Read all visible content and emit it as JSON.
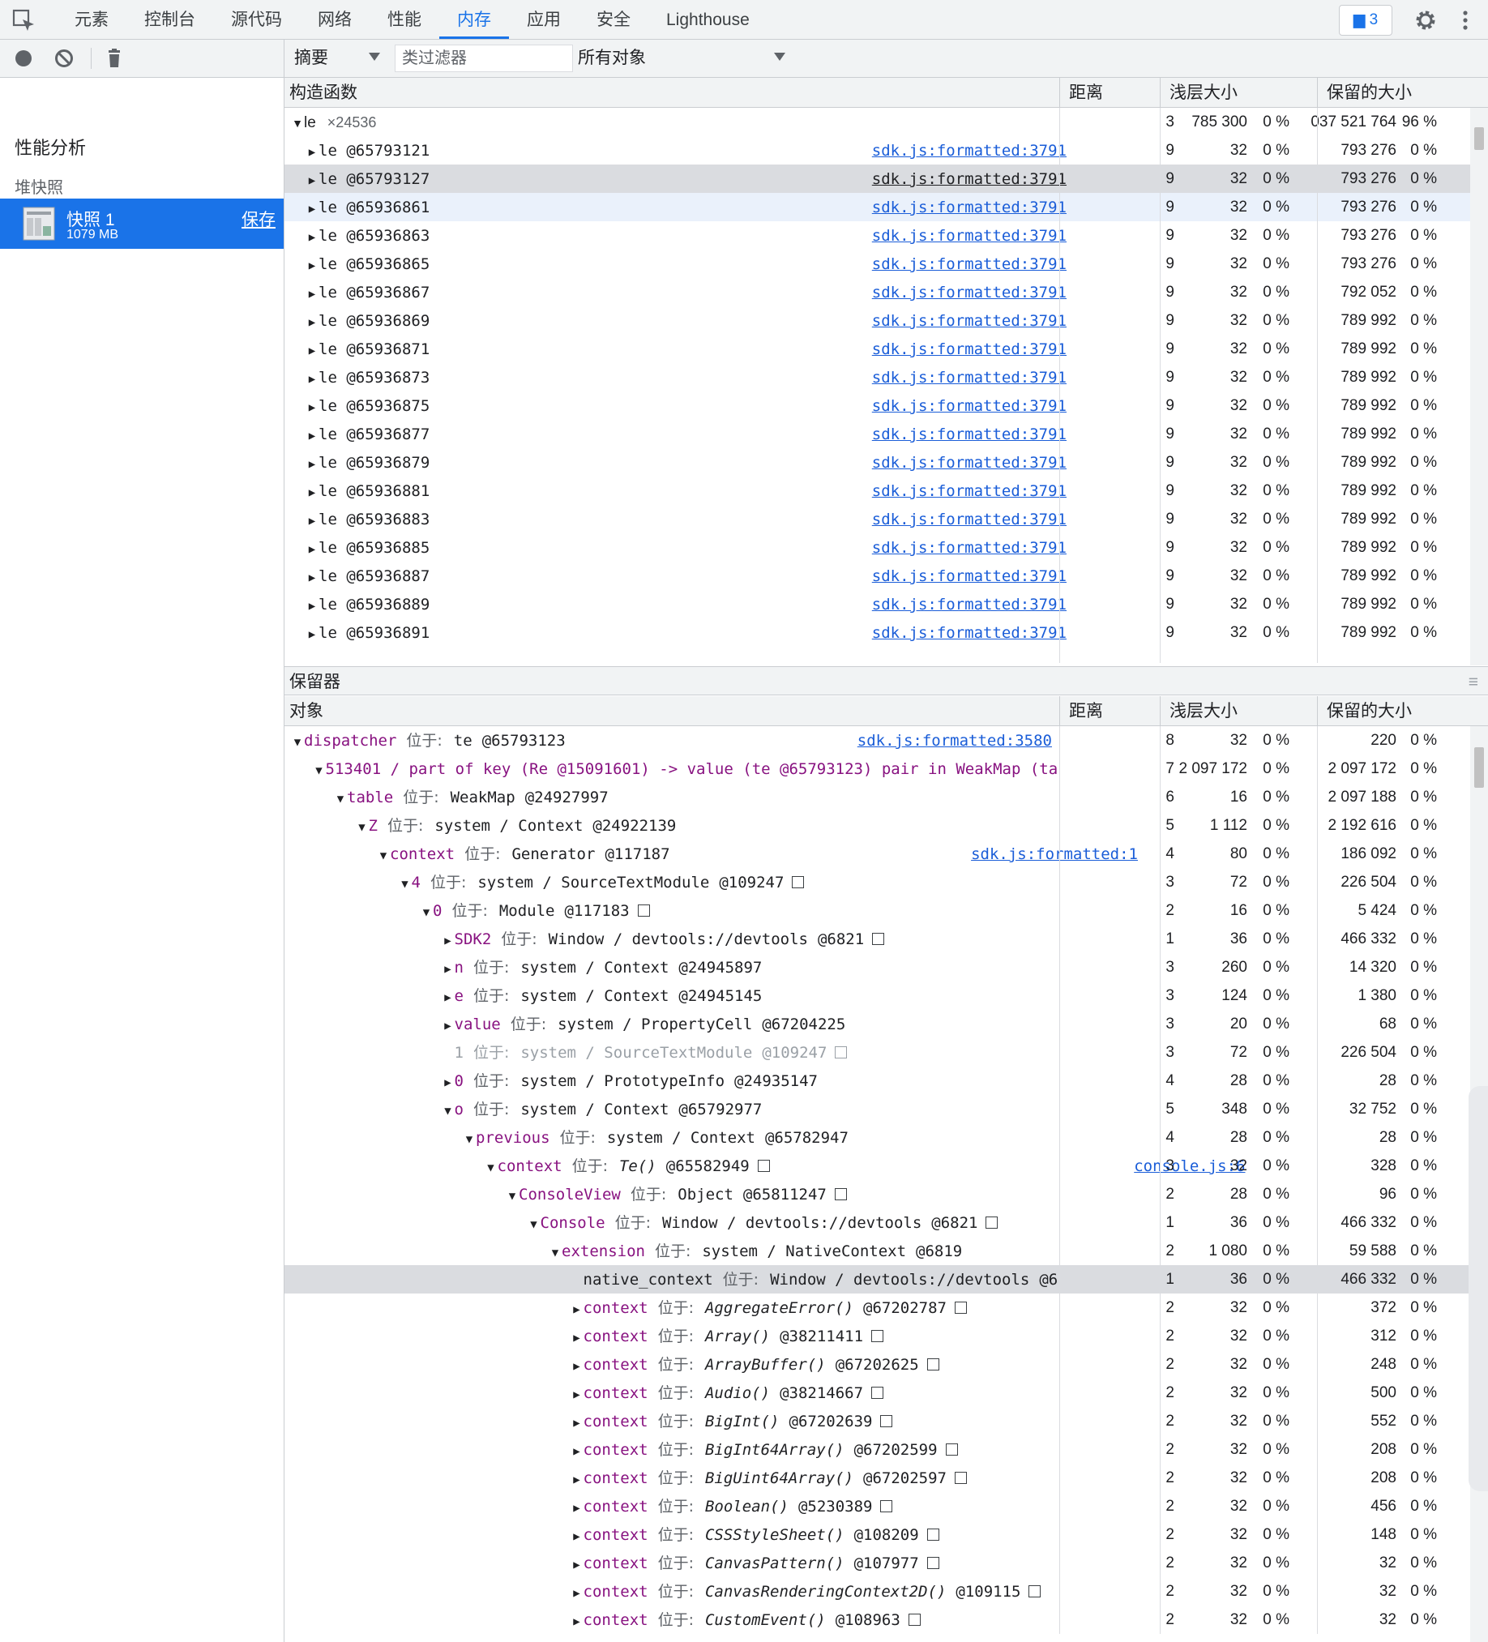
{
  "tabs": [
    "元素",
    "控制台",
    "源代码",
    "网络",
    "性能",
    "内存",
    "应用",
    "安全",
    "Lighthouse"
  ],
  "active_tab": "内存",
  "issues_badge": "3",
  "left": {
    "title": "性能分析",
    "heap_label": "堆快照",
    "snapshot": {
      "name": "快照 1",
      "size": "1079 MB",
      "save": "保存"
    }
  },
  "toolbar": {
    "view": "摘要",
    "class_filter": "类过滤器",
    "objects": "所有对象"
  },
  "top_columns": {
    "name": "构造函数",
    "distance": "距离",
    "shallow": "浅层大小",
    "retained": "保留的大小"
  },
  "top_group": {
    "name": "le",
    "count": "×24536",
    "distance": "3",
    "shallow": "785 300",
    "shallow_pct": "0 %",
    "retained": "037 521 764",
    "retained_pct": "96 %"
  },
  "top_rows": [
    {
      "id": "le @65793121",
      "link": "sdk.js:formatted:3791",
      "distance": "9",
      "shallow": "32",
      "shallow_pct": "0 %",
      "retained": "793 276",
      "retained_pct": "0 %"
    },
    {
      "id": "le @65793127",
      "link": "sdk.js:formatted:3791",
      "distance": "9",
      "shallow": "32",
      "shallow_pct": "0 %",
      "retained": "793 276",
      "retained_pct": "0 %"
    },
    {
      "id": "le @65936861",
      "link": "sdk.js:formatted:3791",
      "distance": "9",
      "shallow": "32",
      "shallow_pct": "0 %",
      "retained": "793 276",
      "retained_pct": "0 %"
    },
    {
      "id": "le @65936863",
      "link": "sdk.js:formatted:3791",
      "distance": "9",
      "shallow": "32",
      "shallow_pct": "0 %",
      "retained": "793 276",
      "retained_pct": "0 %"
    },
    {
      "id": "le @65936865",
      "link": "sdk.js:formatted:3791",
      "distance": "9",
      "shallow": "32",
      "shallow_pct": "0 %",
      "retained": "793 276",
      "retained_pct": "0 %"
    },
    {
      "id": "le @65936867",
      "link": "sdk.js:formatted:3791",
      "distance": "9",
      "shallow": "32",
      "shallow_pct": "0 %",
      "retained": "792 052",
      "retained_pct": "0 %"
    },
    {
      "id": "le @65936869",
      "link": "sdk.js:formatted:3791",
      "distance": "9",
      "shallow": "32",
      "shallow_pct": "0 %",
      "retained": "789 992",
      "retained_pct": "0 %"
    },
    {
      "id": "le @65936871",
      "link": "sdk.js:formatted:3791",
      "distance": "9",
      "shallow": "32",
      "shallow_pct": "0 %",
      "retained": "789 992",
      "retained_pct": "0 %"
    },
    {
      "id": "le @65936873",
      "link": "sdk.js:formatted:3791",
      "distance": "9",
      "shallow": "32",
      "shallow_pct": "0 %",
      "retained": "789 992",
      "retained_pct": "0 %"
    },
    {
      "id": "le @65936875",
      "link": "sdk.js:formatted:3791",
      "distance": "9",
      "shallow": "32",
      "shallow_pct": "0 %",
      "retained": "789 992",
      "retained_pct": "0 %"
    },
    {
      "id": "le @65936877",
      "link": "sdk.js:formatted:3791",
      "distance": "9",
      "shallow": "32",
      "shallow_pct": "0 %",
      "retained": "789 992",
      "retained_pct": "0 %"
    },
    {
      "id": "le @65936879",
      "link": "sdk.js:formatted:3791",
      "distance": "9",
      "shallow": "32",
      "shallow_pct": "0 %",
      "retained": "789 992",
      "retained_pct": "0 %"
    },
    {
      "id": "le @65936881",
      "link": "sdk.js:formatted:3791",
      "distance": "9",
      "shallow": "32",
      "shallow_pct": "0 %",
      "retained": "789 992",
      "retained_pct": "0 %"
    },
    {
      "id": "le @65936883",
      "link": "sdk.js:formatted:3791",
      "distance": "9",
      "shallow": "32",
      "shallow_pct": "0 %",
      "retained": "789 992",
      "retained_pct": "0 %"
    },
    {
      "id": "le @65936885",
      "link": "sdk.js:formatted:3791",
      "distance": "9",
      "shallow": "32",
      "shallow_pct": "0 %",
      "retained": "789 992",
      "retained_pct": "0 %"
    },
    {
      "id": "le @65936887",
      "link": "sdk.js:formatted:3791",
      "distance": "9",
      "shallow": "32",
      "shallow_pct": "0 %",
      "retained": "789 992",
      "retained_pct": "0 %"
    },
    {
      "id": "le @65936889",
      "link": "sdk.js:formatted:3791",
      "distance": "9",
      "shallow": "32",
      "shallow_pct": "0 %",
      "retained": "789 992",
      "retained_pct": "0 %"
    },
    {
      "id": "le @65936891",
      "link": "sdk.js:formatted:3791",
      "distance": "9",
      "shallow": "32",
      "shallow_pct": "0 %",
      "retained": "789 992",
      "retained_pct": "0 %"
    }
  ],
  "retainers_title": "保留器",
  "bottom_columns": {
    "name": "对象",
    "distance": "距离",
    "shallow": "浅层大小",
    "retained": "保留的大小"
  },
  "bottom_rows": [
    {
      "depth": 0,
      "arrow": "▼",
      "prop": "dispatcher",
      "at": "位于:",
      "type": "te",
      "id": "@65793123",
      "link": "sdk.js:formatted:3580",
      "distance": "8",
      "shallow": "32",
      "shallow_pct": "0 %",
      "retained": "220",
      "retained_pct": "0 %"
    },
    {
      "depth": 1,
      "arrow": "▼",
      "prop": "513401 / part of key (Re @15091601) -> value (te @65793123) pair in WeakMap (ta",
      "at": "",
      "type": "",
      "id": "",
      "distance": "7",
      "shallow": "2 097 172",
      "shallow_pct": "0 %",
      "retained": "2 097 172",
      "retained_pct": "0 %"
    },
    {
      "depth": 2,
      "arrow": "▼",
      "prop": "table",
      "at": "位于:",
      "type": "WeakMap",
      "id": "@24927997",
      "distance": "6",
      "shallow": "16",
      "shallow_pct": "0 %",
      "retained": "2 097 188",
      "retained_pct": "0 %"
    },
    {
      "depth": 3,
      "arrow": "▼",
      "prop": "Z",
      "at": "位于:",
      "type": "system / Context",
      "id": "@24922139",
      "distance": "5",
      "shallow": "1 112",
      "shallow_pct": "0 %",
      "retained": "2 192 616",
      "retained_pct": "0 %"
    },
    {
      "depth": 4,
      "arrow": "▼",
      "prop": "context",
      "at": "位于:",
      "type": "Generator",
      "id": "@117187",
      "link": "sdk.js:formatted:1",
      "distance": "4",
      "shallow": "80",
      "shallow_pct": "0 %",
      "retained": "186 092",
      "retained_pct": "0 %"
    },
    {
      "depth": 5,
      "arrow": "▼",
      "prop": "4",
      "at": "位于:",
      "type": "system / SourceTextModule",
      "id": "@109247",
      "box": true,
      "distance": "3",
      "shallow": "72",
      "shallow_pct": "0 %",
      "retained": "226 504",
      "retained_pct": "0 %"
    },
    {
      "depth": 6,
      "arrow": "▼",
      "prop": "0",
      "at": "位于:",
      "type": "Module",
      "id": "@117183",
      "box": true,
      "distance": "2",
      "shallow": "16",
      "shallow_pct": "0 %",
      "retained": "5 424",
      "retained_pct": "0 %"
    },
    {
      "depth": 7,
      "arrow": "▶",
      "prop": "SDK2",
      "at": "位于:",
      "type": "Window / devtools://devtools",
      "id": "@6821",
      "box": true,
      "distance": "1",
      "shallow": "36",
      "shallow_pct": "0 %",
      "retained": "466 332",
      "retained_pct": "0 %"
    },
    {
      "depth": 7,
      "arrow": "▶",
      "prop": "n",
      "at": "位于:",
      "type": "system / Context",
      "id": "@24945897",
      "distance": "3",
      "shallow": "260",
      "shallow_pct": "0 %",
      "retained": "14 320",
      "retained_pct": "0 %"
    },
    {
      "depth": 7,
      "arrow": "▶",
      "prop": "e",
      "at": "位于:",
      "type": "system / Context",
      "id": "@24945145",
      "distance": "3",
      "shallow": "124",
      "shallow_pct": "0 %",
      "retained": "1 380",
      "retained_pct": "0 %"
    },
    {
      "depth": 7,
      "arrow": "▶",
      "prop": "value",
      "at": "位于:",
      "type": "system / PropertyCell",
      "id": "@67204225",
      "distance": "3",
      "shallow": "20",
      "shallow_pct": "0 %",
      "retained": "68",
      "retained_pct": "0 %"
    },
    {
      "depth": 7,
      "arrow": "",
      "prop": "1",
      "at": "位于:",
      "type": "system / SourceTextModule",
      "id": "@109247",
      "box": true,
      "dim": true,
      "distance": "3",
      "shallow": "72",
      "shallow_pct": "0 %",
      "retained": "226 504",
      "retained_pct": "0 %"
    },
    {
      "depth": 7,
      "arrow": "▶",
      "prop": "0",
      "at": "位于:",
      "type": "system / PrototypeInfo",
      "id": "@24935147",
      "distance": "4",
      "shallow": "28",
      "shallow_pct": "0 %",
      "retained": "28",
      "retained_pct": "0 %"
    },
    {
      "depth": 7,
      "arrow": "▼",
      "prop": "o",
      "at": "位于:",
      "type": "system / Context",
      "id": "@65792977",
      "distance": "5",
      "shallow": "348",
      "shallow_pct": "0 %",
      "retained": "32 752",
      "retained_pct": "0 %"
    },
    {
      "depth": 8,
      "arrow": "▼",
      "prop": "previous",
      "at": "位于:",
      "type": "system / Context",
      "id": "@65782947",
      "distance": "4",
      "shallow": "28",
      "shallow_pct": "0 %",
      "retained": "28",
      "retained_pct": "0 %"
    },
    {
      "depth": 9,
      "arrow": "▼",
      "prop": "context",
      "at": "位于:",
      "type": "Te()",
      "italic": true,
      "id": "@65582949",
      "box": true,
      "link": "console.js:6",
      "distance": "3",
      "shallow": "32",
      "shallow_pct": "0 %",
      "retained": "328",
      "retained_pct": "0 %"
    },
    {
      "depth": 10,
      "arrow": "▼",
      "prop": "ConsoleView",
      "at": "位于:",
      "type": "Object",
      "id": "@65811247",
      "box": true,
      "distance": "2",
      "shallow": "28",
      "shallow_pct": "0 %",
      "retained": "96",
      "retained_pct": "0 %"
    },
    {
      "depth": 11,
      "arrow": "▼",
      "prop": "Console",
      "at": "位于:",
      "type": "Window / devtools://devtools",
      "id": "@6821",
      "box": true,
      "distance": "1",
      "shallow": "36",
      "shallow_pct": "0 %",
      "retained": "466 332",
      "retained_pct": "0 %"
    },
    {
      "depth": 12,
      "arrow": "▼",
      "prop": "extension",
      "at": "位于:",
      "type": "system / NativeContext",
      "id": "@6819",
      "distance": "2",
      "shallow": "1 080",
      "shallow_pct": "0 %",
      "retained": "59 588",
      "retained_pct": "0 %"
    },
    {
      "depth": 13,
      "arrow": "",
      "prop": "native_context",
      "at": "位于:",
      "type": "Window / devtools://devtools",
      "id": "@6",
      "selected": true,
      "plain": true,
      "distance": "1",
      "shallow": "36",
      "shallow_pct": "0 %",
      "retained": "466 332",
      "retained_pct": "0 %"
    },
    {
      "depth": 13,
      "arrow": "▶",
      "prop": "context",
      "at": "位于:",
      "type": "AggregateError()",
      "italic": true,
      "id": "@67202787",
      "box": true,
      "distance": "2",
      "shallow": "32",
      "shallow_pct": "0 %",
      "retained": "372",
      "retained_pct": "0 %"
    },
    {
      "depth": 13,
      "arrow": "▶",
      "prop": "context",
      "at": "位于:",
      "type": "Array()",
      "italic": true,
      "id": "@38211411",
      "box": true,
      "distance": "2",
      "shallow": "32",
      "shallow_pct": "0 %",
      "retained": "312",
      "retained_pct": "0 %"
    },
    {
      "depth": 13,
      "arrow": "▶",
      "prop": "context",
      "at": "位于:",
      "type": "ArrayBuffer()",
      "italic": true,
      "id": "@67202625",
      "box": true,
      "distance": "2",
      "shallow": "32",
      "shallow_pct": "0 %",
      "retained": "248",
      "retained_pct": "0 %"
    },
    {
      "depth": 13,
      "arrow": "▶",
      "prop": "context",
      "at": "位于:",
      "type": "Audio()",
      "italic": true,
      "id": "@38214667",
      "box": true,
      "distance": "2",
      "shallow": "32",
      "shallow_pct": "0 %",
      "retained": "500",
      "retained_pct": "0 %"
    },
    {
      "depth": 13,
      "arrow": "▶",
      "prop": "context",
      "at": "位于:",
      "type": "BigInt()",
      "italic": true,
      "id": "@67202639",
      "box": true,
      "distance": "2",
      "shallow": "32",
      "shallow_pct": "0 %",
      "retained": "552",
      "retained_pct": "0 %"
    },
    {
      "depth": 13,
      "arrow": "▶",
      "prop": "context",
      "at": "位于:",
      "type": "BigInt64Array()",
      "italic": true,
      "id": "@67202599",
      "box": true,
      "distance": "2",
      "shallow": "32",
      "shallow_pct": "0 %",
      "retained": "208",
      "retained_pct": "0 %"
    },
    {
      "depth": 13,
      "arrow": "▶",
      "prop": "context",
      "at": "位于:",
      "type": "BigUint64Array()",
      "italic": true,
      "id": "@67202597",
      "box": true,
      "distance": "2",
      "shallow": "32",
      "shallow_pct": "0 %",
      "retained": "208",
      "retained_pct": "0 %"
    },
    {
      "depth": 13,
      "arrow": "▶",
      "prop": "context",
      "at": "位于:",
      "type": "Boolean()",
      "italic": true,
      "id": "@5230389",
      "box": true,
      "distance": "2",
      "shallow": "32",
      "shallow_pct": "0 %",
      "retained": "456",
      "retained_pct": "0 %"
    },
    {
      "depth": 13,
      "arrow": "▶",
      "prop": "context",
      "at": "位于:",
      "type": "CSSStyleSheet()",
      "italic": true,
      "id": "@108209",
      "box": true,
      "distance": "2",
      "shallow": "32",
      "shallow_pct": "0 %",
      "retained": "148",
      "retained_pct": "0 %"
    },
    {
      "depth": 13,
      "arrow": "▶",
      "prop": "context",
      "at": "位于:",
      "type": "CanvasPattern()",
      "italic": true,
      "id": "@107977",
      "box": true,
      "distance": "2",
      "shallow": "32",
      "shallow_pct": "0 %",
      "retained": "32",
      "retained_pct": "0 %"
    },
    {
      "depth": 13,
      "arrow": "▶",
      "prop": "context",
      "at": "位于:",
      "type": "CanvasRenderingContext2D()",
      "italic": true,
      "id": "@109115",
      "box": true,
      "distance": "2",
      "shallow": "32",
      "shallow_pct": "0 %",
      "retained": "32",
      "retained_pct": "0 %"
    },
    {
      "depth": 13,
      "arrow": "▶",
      "prop": "context",
      "at": "位于:",
      "type": "CustomEvent()",
      "italic": true,
      "id": "@108963",
      "box": true,
      "distance": "2",
      "shallow": "32",
      "shallow_pct": "0 %",
      "retained": "32",
      "retained_pct": "0 %"
    }
  ],
  "colors": {
    "accent": "#1a73e8",
    "link": "#1a5dd8",
    "property": "#881280",
    "selected_row": "#dadce0"
  }
}
